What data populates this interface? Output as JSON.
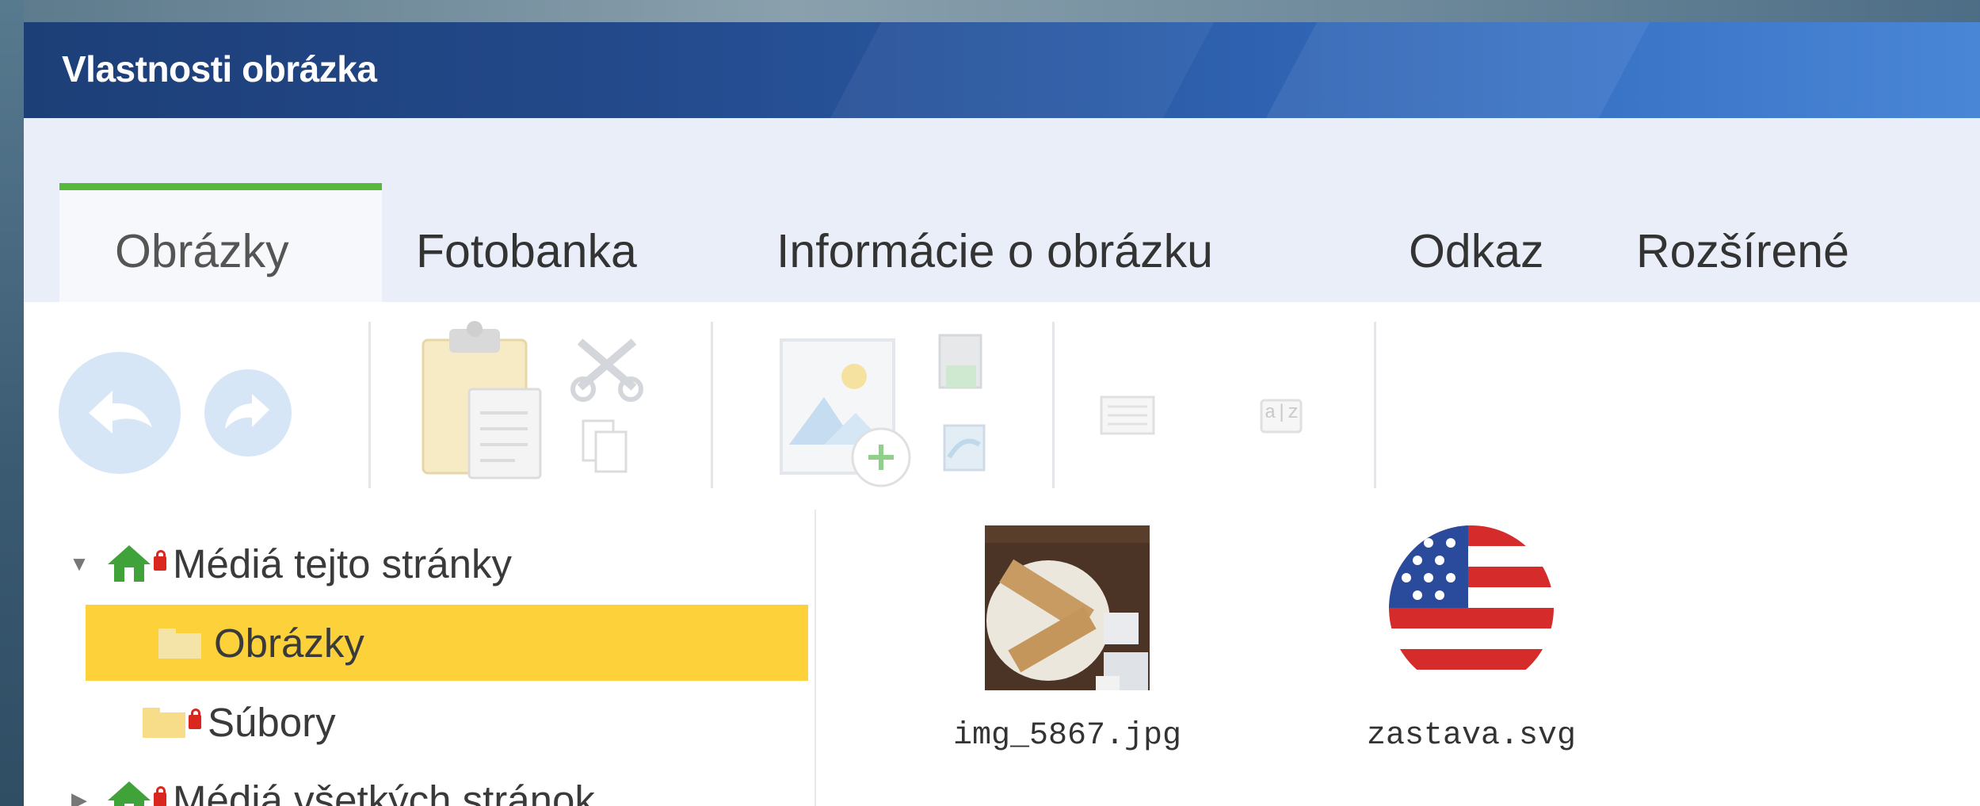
{
  "dialog": {
    "title": "Vlastnosti obrázka"
  },
  "tabs": [
    {
      "label": "Obrázky",
      "active": true
    },
    {
      "label": "Fotobanka",
      "active": false
    },
    {
      "label": "Informácie o obrázku",
      "active": false
    },
    {
      "label": "Odkaz",
      "active": false
    },
    {
      "label": "Rozšírené",
      "active": false
    }
  ],
  "toolbar": {
    "groups": [
      [
        "back-icon",
        "forward-icon"
      ],
      [
        "clipboard-paste-icon",
        "cut-icon",
        "copy-icon"
      ],
      [
        "add-image-icon",
        "move-file-icon",
        "refresh-file-icon"
      ],
      [
        "list-view-icon",
        "sort-az-icon"
      ]
    ],
    "sort_label": "a|z",
    "enabled": false
  },
  "tree": {
    "nodes": [
      {
        "label": "Médiá tejto stránky",
        "expanded": true
      },
      {
        "label": "Obrázky",
        "selected": true
      },
      {
        "label": "Súbory"
      },
      {
        "label": "Médiá všetkých stránok",
        "expanded": false
      }
    ]
  },
  "files": [
    {
      "name": "img_5867.jpg"
    },
    {
      "name": "zastava.svg"
    }
  ],
  "colors": {
    "title_gradient_start": "#1d3f78",
    "title_gradient_end": "#4a86d6",
    "active_tab_accent": "#56b93c",
    "selection": "#fcd13a",
    "lock": "#d9271f",
    "home": "#3fa33a"
  }
}
